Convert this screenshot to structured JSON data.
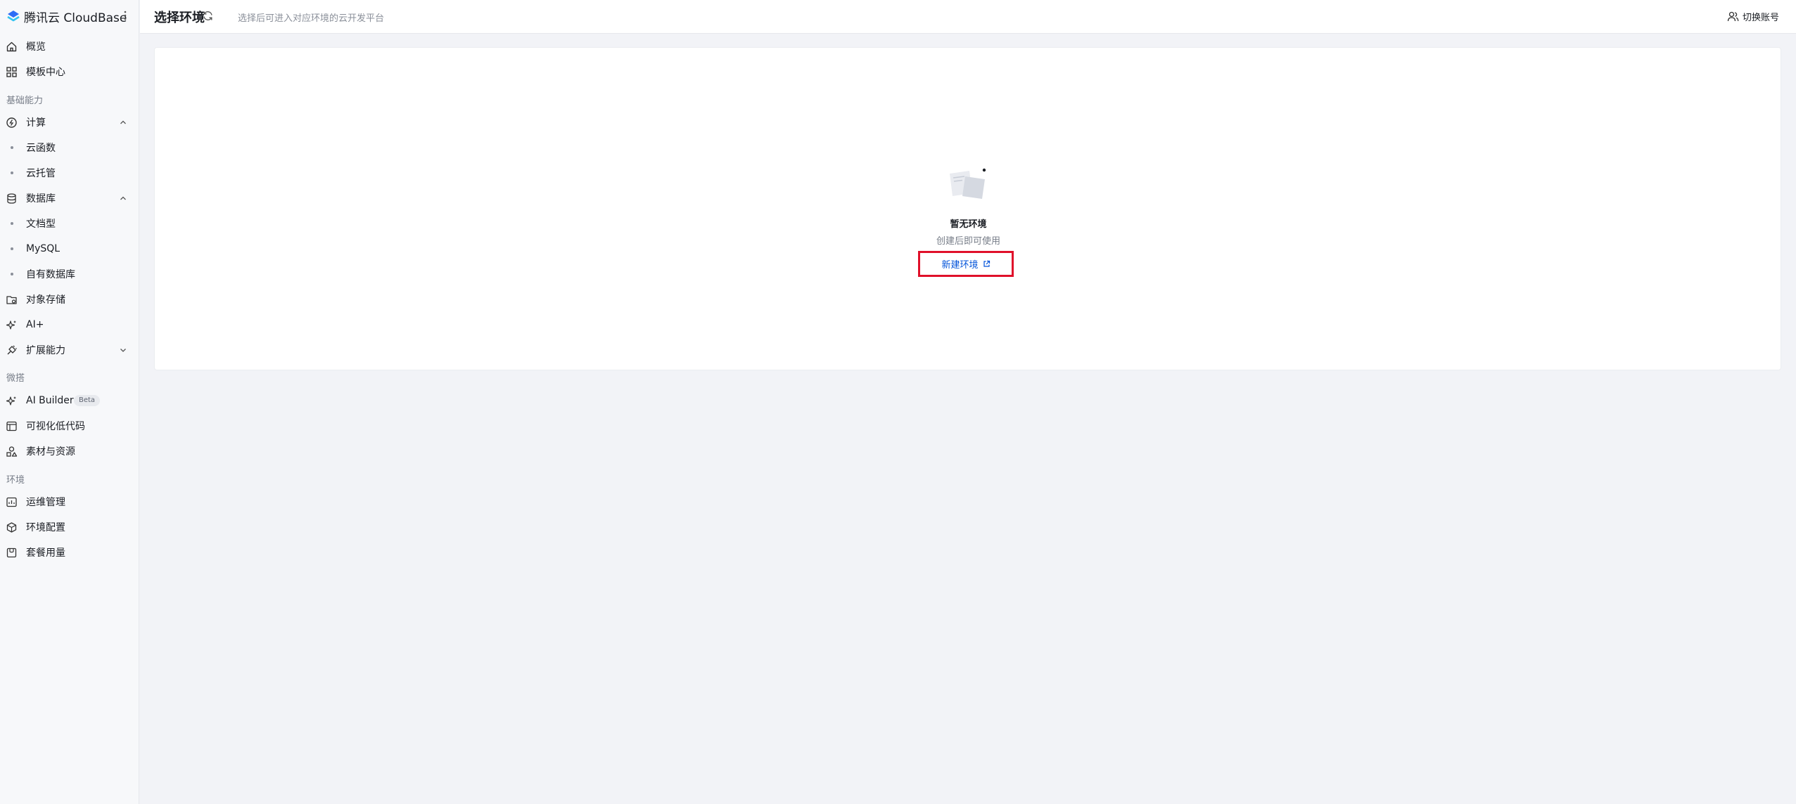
{
  "brand": {
    "name": "腾讯云 CloudBase"
  },
  "sidebar": {
    "items": [
      {
        "label": "概览",
        "icon": "home-icon"
      },
      {
        "label": "模板中心",
        "icon": "grid-icon"
      },
      {
        "label": "计算",
        "icon": "compute-icon"
      },
      {
        "label": "云函数"
      },
      {
        "label": "云托管"
      },
      {
        "label": "数据库",
        "icon": "database-icon"
      },
      {
        "label": "文档型"
      },
      {
        "label": "MySQL"
      },
      {
        "label": "自有数据库"
      },
      {
        "label": "对象存储",
        "icon": "folder-icon"
      },
      {
        "label": "AI+",
        "icon": "sparkle-icon"
      },
      {
        "label": "扩展能力",
        "icon": "plug-icon"
      },
      {
        "label": "AI Builder",
        "icon": "sparkle-icon",
        "badge": "Beta"
      },
      {
        "label": "可视化低代码",
        "icon": "layout-icon"
      },
      {
        "label": "素材与资源",
        "icon": "shapes-icon"
      },
      {
        "label": "运维管理",
        "icon": "monitor-icon"
      },
      {
        "label": "环境配置",
        "icon": "cube-icon"
      },
      {
        "label": "套餐用量",
        "icon": "package-icon"
      }
    ],
    "groups": [
      "基础能力",
      "微搭",
      "环境"
    ]
  },
  "header": {
    "title": "选择环境",
    "hint": "选择后可进入对应环境的云开发平台",
    "switch_account": "切换账号"
  },
  "empty": {
    "title": "暂无环境",
    "desc": "创建后即可使用",
    "create_label": "新建环境"
  },
  "colors": {
    "accent": "#0052d9",
    "highlight": "#e0102a",
    "background": "#f2f3f7",
    "sidebar_bg": "#f7f8fa"
  }
}
